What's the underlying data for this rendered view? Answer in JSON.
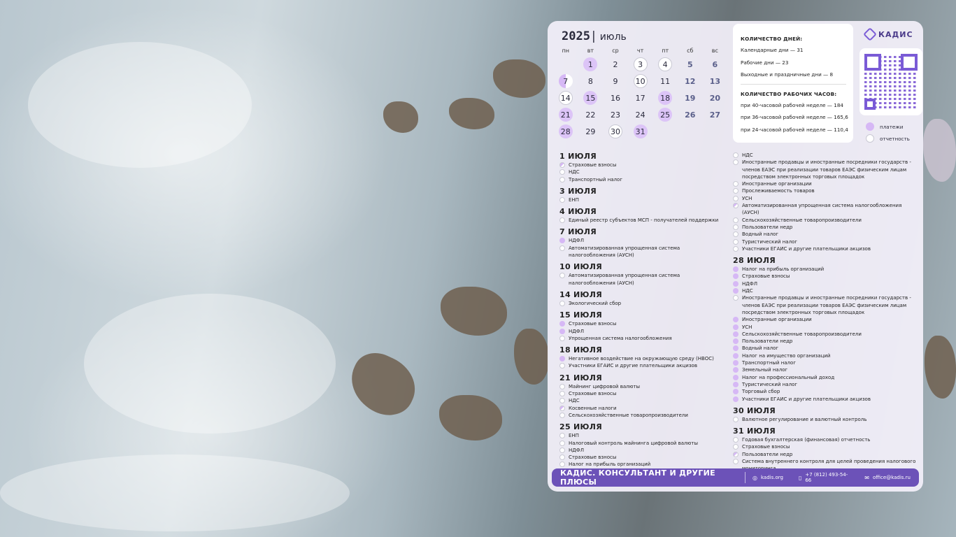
{
  "calendar": {
    "year": "2025",
    "separator": "|",
    "month": "июль",
    "weekdays": [
      "пн",
      "вт",
      "ср",
      "чт",
      "пт",
      "сб",
      "вс"
    ],
    "weeks": [
      [
        {
          "d": ""
        },
        {
          "d": "1",
          "t": "pay"
        },
        {
          "d": "2"
        },
        {
          "d": "3",
          "t": "rep"
        },
        {
          "d": "4",
          "t": "rep"
        },
        {
          "d": "5",
          "t": "wkend"
        },
        {
          "d": "6",
          "t": "wkend"
        }
      ],
      [
        {
          "d": "7",
          "t": "half"
        },
        {
          "d": "8"
        },
        {
          "d": "9"
        },
        {
          "d": "10",
          "t": "rep"
        },
        {
          "d": "11"
        },
        {
          "d": "12",
          "t": "wkend"
        },
        {
          "d": "13",
          "t": "wkend"
        }
      ],
      [
        {
          "d": "14",
          "t": "rep"
        },
        {
          "d": "15",
          "t": "pay"
        },
        {
          "d": "16"
        },
        {
          "d": "17"
        },
        {
          "d": "18",
          "t": "pay"
        },
        {
          "d": "19",
          "t": "wkend"
        },
        {
          "d": "20",
          "t": "wkend"
        }
      ],
      [
        {
          "d": "21",
          "t": "pay"
        },
        {
          "d": "22"
        },
        {
          "d": "23"
        },
        {
          "d": "24"
        },
        {
          "d": "25",
          "t": "pay"
        },
        {
          "d": "26",
          "t": "wkend"
        },
        {
          "d": "27",
          "t": "wkend"
        }
      ],
      [
        {
          "d": "28",
          "t": "pay"
        },
        {
          "d": "29"
        },
        {
          "d": "30",
          "t": "rep"
        },
        {
          "d": "31",
          "t": "pay"
        },
        {
          "d": ""
        },
        {
          "d": ""
        },
        {
          "d": ""
        }
      ]
    ]
  },
  "info": {
    "days_heading": "КОЛИЧЕСТВО ДНЕЙ:",
    "days_lines": [
      "Календарные дни — 31",
      "Рабочие дни — 23",
      "Выходные и праздничные дни — 8"
    ],
    "hours_heading": "КОЛИЧЕСТВО РАБОЧИХ ЧАСОВ:",
    "hours_lines": [
      "при 40-часовой рабочей неделе — 184",
      "при 36-часовой рабочей неделе — 165,6",
      "при 24-часовой рабочей неделе — 110,4"
    ]
  },
  "brand": {
    "name": "КАДИС"
  },
  "legend": {
    "payments": "платежи",
    "reports": "отчетность"
  },
  "colors": {
    "payment": "#d6b8f5",
    "accent": "#6c52b8",
    "report": "#ffffff"
  },
  "events_left": [
    {
      "date": "1 ИЮЛЯ",
      "items": [
        {
          "t": "Страховые взносы",
          "k": "half"
        },
        {
          "t": "НДС",
          "k": "rep"
        },
        {
          "t": "Транспортный налог",
          "k": "rep"
        }
      ]
    },
    {
      "date": "3 ИЮЛЯ",
      "items": [
        {
          "t": "ЕНП",
          "k": "rep"
        }
      ]
    },
    {
      "date": "4 ИЮЛЯ",
      "items": [
        {
          "t": "Единый реестр субъектов МСП - получателей поддержки",
          "k": "rep"
        }
      ]
    },
    {
      "date": "7 ИЮЛЯ",
      "items": [
        {
          "t": "НДФЛ",
          "k": "pay"
        },
        {
          "t": "Автоматизированная упрощенная система налогообложения (АУСН)",
          "k": "rep"
        }
      ]
    },
    {
      "date": "10 ИЮЛЯ",
      "items": [
        {
          "t": "Автоматизированная упрощенная система налогообложения (АУСН)",
          "k": "rep"
        }
      ]
    },
    {
      "date": "14 ИЮЛЯ",
      "items": [
        {
          "t": "Экологический сбор",
          "k": "rep"
        }
      ]
    },
    {
      "date": "15 ИЮЛЯ",
      "items": [
        {
          "t": "Страховые взносы",
          "k": "pay"
        },
        {
          "t": "НДФЛ",
          "k": "pay"
        },
        {
          "t": "Упрощенная система налогообложения",
          "k": "rep"
        }
      ]
    },
    {
      "date": "18 ИЮЛЯ",
      "items": [
        {
          "t": "Негативное воздействие на окружающую среду (НВОС)",
          "k": "pay"
        },
        {
          "t": "Участники ЕГАИС и другие плательщики акцизов",
          "k": "rep"
        }
      ]
    },
    {
      "date": "21 ИЮЛЯ",
      "items": [
        {
          "t": "Майнинг цифровой валюты",
          "k": "rep"
        },
        {
          "t": "Страховые взносы",
          "k": "rep"
        },
        {
          "t": "НДС",
          "k": "rep"
        },
        {
          "t": "Косвенные налоги",
          "k": "half"
        },
        {
          "t": "Сельскохозяйственные товаропроизводители",
          "k": "rep"
        }
      ]
    },
    {
      "date": "25 ИЮЛЯ",
      "items": [
        {
          "t": "ЕНП",
          "k": "rep"
        },
        {
          "t": "Налоговый контроль майнинга цифровой валюты",
          "k": "rep"
        },
        {
          "t": "НДФЛ",
          "k": "rep"
        },
        {
          "t": "Страховые взносы",
          "k": "rep"
        },
        {
          "t": "Налог на прибыль организаций",
          "k": "rep"
        }
      ]
    }
  ],
  "events_right": [
    {
      "date": "",
      "items": [
        {
          "t": "НДС",
          "k": "rep"
        },
        {
          "t": "Иностранные продавцы и иностранные посредники государств - членов ЕАЭС при реализации товаров ЕАЭС физическим лицам посредством электронных торговых площадок",
          "k": "rep"
        },
        {
          "t": "Иностранные организации",
          "k": "rep"
        },
        {
          "t": "Прослеживаемость товаров",
          "k": "rep"
        },
        {
          "t": "УСН",
          "k": "rep"
        },
        {
          "t": "Автоматизированная упрощенная система налогообложения (АУСН)",
          "k": "half"
        },
        {
          "t": "Сельскохозяйственные товаропроизводители",
          "k": "rep"
        },
        {
          "t": "Пользователи недр",
          "k": "rep"
        },
        {
          "t": "Водный налог",
          "k": "rep"
        },
        {
          "t": "Туристический налог",
          "k": "rep"
        },
        {
          "t": "Участники ЕГАИС и другие плательщики акцизов",
          "k": "rep"
        }
      ]
    },
    {
      "date": "28 ИЮЛЯ",
      "items": [
        {
          "t": "Налог на прибыль организаций",
          "k": "pay"
        },
        {
          "t": "Страховые взносы",
          "k": "pay"
        },
        {
          "t": "НДФЛ",
          "k": "pay"
        },
        {
          "t": "НДС",
          "k": "pay"
        },
        {
          "t": "Иностранные продавцы и иностранные посредники государств - членов ЕАЭС при реализации товаров ЕАЭС физическим лицам посредством электронных торговых площадок",
          "k": "rep"
        },
        {
          "t": "Иностранные организации",
          "k": "pay"
        },
        {
          "t": "УСН",
          "k": "pay"
        },
        {
          "t": "Сельскохозяйственные товаропроизводители",
          "k": "pay"
        },
        {
          "t": "Пользователи недр",
          "k": "pay"
        },
        {
          "t": "Водный налог",
          "k": "pay"
        },
        {
          "t": "Налог на имущество организаций",
          "k": "pay"
        },
        {
          "t": "Транспортный налог",
          "k": "pay"
        },
        {
          "t": "Земельный налог",
          "k": "pay"
        },
        {
          "t": "Налог на профессиональный доход",
          "k": "pay"
        },
        {
          "t": "Туристический налог",
          "k": "pay"
        },
        {
          "t": "Торговый сбор",
          "k": "pay"
        },
        {
          "t": "Участники ЕГАИС и другие плательщики акцизов",
          "k": "pay"
        }
      ]
    },
    {
      "date": "30 ИЮЛЯ",
      "items": [
        {
          "t": "Валютное регулирование и валютный контроль",
          "k": "rep"
        }
      ]
    },
    {
      "date": "31 ИЮЛЯ",
      "items": [
        {
          "t": "Годовая бухгалтерская (финансовая) отчетность",
          "k": "rep"
        },
        {
          "t": "Страховые взносы",
          "k": "rep"
        },
        {
          "t": "Пользователи недр",
          "k": "half"
        },
        {
          "t": "Система внутреннего контроля для целей проведения налогового мониторинга",
          "k": "rep"
        }
      ]
    }
  ],
  "footer": {
    "title": "КАДИС. КОНСУЛЬТАНТ И ДРУГИЕ ПЛЮСЫ",
    "site": "kadis.org",
    "phone": "+7 (812) 493-54-66",
    "email": "office@kadis.ru"
  }
}
